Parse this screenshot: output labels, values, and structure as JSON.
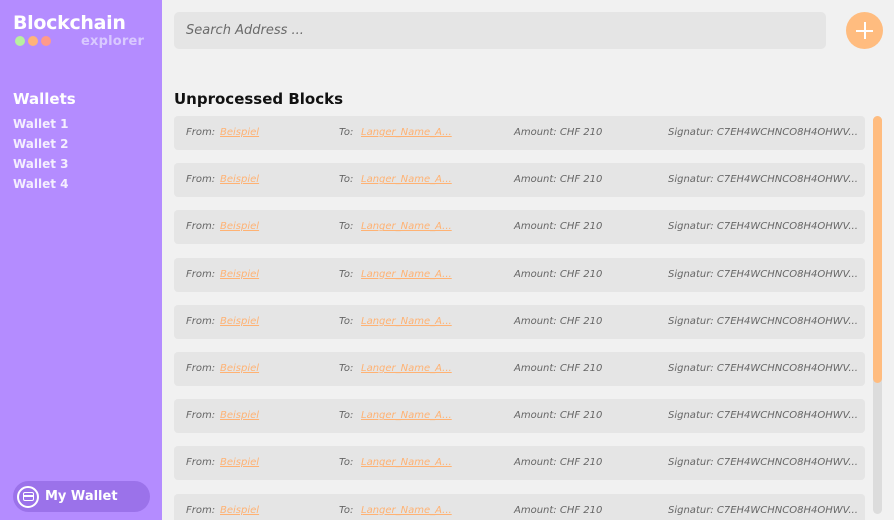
{
  "app": {
    "title": "Blockchain",
    "subtitle": "explorer",
    "dot_colors": [
      "#b8f0a0",
      "#ffb37a",
      "#ff9a8a"
    ]
  },
  "sidebar": {
    "heading": "Wallets",
    "items": [
      {
        "label": "Wallet 1"
      },
      {
        "label": "Wallet 2"
      },
      {
        "label": "Wallet 3"
      },
      {
        "label": "Wallet 4"
      }
    ],
    "my_wallet_label": "My Wallet"
  },
  "search": {
    "placeholder": "Search Address ...",
    "value": ""
  },
  "main": {
    "section_title": "Unprocessed Blocks",
    "blocks": [
      {
        "from_label": "From:",
        "from": "Beispiel",
        "to_label": "To:",
        "to": "Langer_Name_A...",
        "amount": "Amount: CHF 210",
        "signature": "Signatur: C7EH4WCHNCO8H4OHWV..."
      },
      {
        "from_label": "From:",
        "from": "Beispiel",
        "to_label": "To:",
        "to": "Langer_Name_A...",
        "amount": "Amount: CHF 210",
        "signature": "Signatur: C7EH4WCHNCO8H4OHWV..."
      },
      {
        "from_label": "From:",
        "from": "Beispiel",
        "to_label": "To:",
        "to": "Langer_Name_A...",
        "amount": "Amount: CHF 210",
        "signature": "Signatur: C7EH4WCHNCO8H4OHWV..."
      },
      {
        "from_label": "From:",
        "from": "Beispiel",
        "to_label": "To:",
        "to": "Langer_Name_A...",
        "amount": "Amount: CHF 210",
        "signature": "Signatur: C7EH4WCHNCO8H4OHWV..."
      },
      {
        "from_label": "From:",
        "from": "Beispiel",
        "to_label": "To:",
        "to": "Langer_Name_A...",
        "amount": "Amount: CHF 210",
        "signature": "Signatur: C7EH4WCHNCO8H4OHWV..."
      },
      {
        "from_label": "From:",
        "from": "Beispiel",
        "to_label": "To:",
        "to": "Langer_Name_A...",
        "amount": "Amount: CHF 210",
        "signature": "Signatur: C7EH4WCHNCO8H4OHWV..."
      },
      {
        "from_label": "From:",
        "from": "Beispiel",
        "to_label": "To:",
        "to": "Langer_Name_A...",
        "amount": "Amount: CHF 210",
        "signature": "Signatur: C7EH4WCHNCO8H4OHWV..."
      },
      {
        "from_label": "From:",
        "from": "Beispiel",
        "to_label": "To:",
        "to": "Langer_Name_A...",
        "amount": "Amount: CHF 210",
        "signature": "Signatur: C7EH4WCHNCO8H4OHWV..."
      },
      {
        "from_label": "From:",
        "from": "Beispiel",
        "to_label": "To:",
        "to": "Langer_Name_A...",
        "amount": "Amount: CHF 210",
        "signature": "Signatur: C7EH4WCHNCO8H4OHWV..."
      }
    ]
  },
  "colors": {
    "sidebar": "#b48cff",
    "accent": "#ffbc7f",
    "link": "#ffb273",
    "background": "#f1f1f1",
    "row": "#e5e5e5"
  },
  "icons": {
    "add": "plus-icon",
    "wallet": "wallet-icon"
  },
  "scroll": {
    "visible_fraction": 0.67
  }
}
